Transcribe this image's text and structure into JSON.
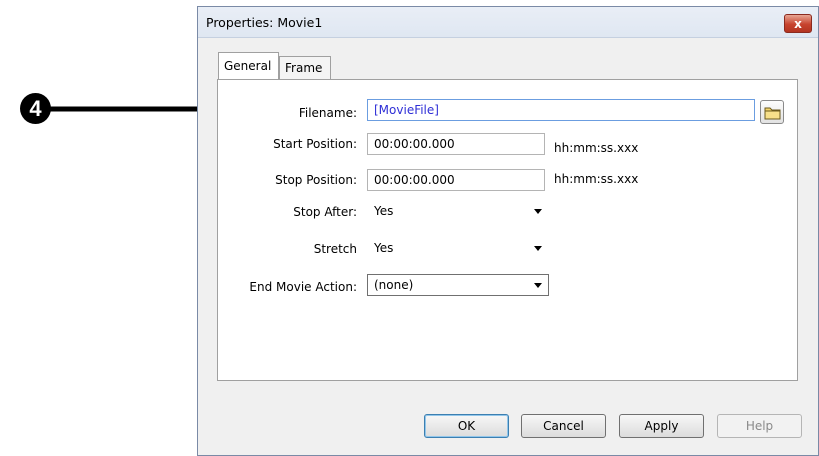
{
  "callout": {
    "number": "4"
  },
  "dialog": {
    "title": "Properties: Movie1",
    "close_label": "x"
  },
  "tabs": [
    {
      "label": "General",
      "active": true
    },
    {
      "label": "Frame",
      "active": false
    }
  ],
  "form": {
    "filename": {
      "label": "Filename:",
      "value": "[MovieFile]"
    },
    "start_position": {
      "label": "Start Position:",
      "value": "00:00:00.000",
      "unit": "hh:mm:ss.xxx"
    },
    "stop_position": {
      "label": "Stop Position:",
      "value": "00:00:00.000",
      "unit": "hh:mm:ss.xxx"
    },
    "stop_after": {
      "label": "Stop After:",
      "value": "Yes"
    },
    "stretch": {
      "label": "Stretch",
      "value": "Yes"
    },
    "end_movie_action": {
      "label": "End Movie Action:",
      "value": "(none)"
    }
  },
  "buttons": {
    "ok": "OK",
    "cancel": "Cancel",
    "apply": "Apply",
    "help": "Help"
  },
  "icons": {
    "browse": "folder-icon"
  }
}
